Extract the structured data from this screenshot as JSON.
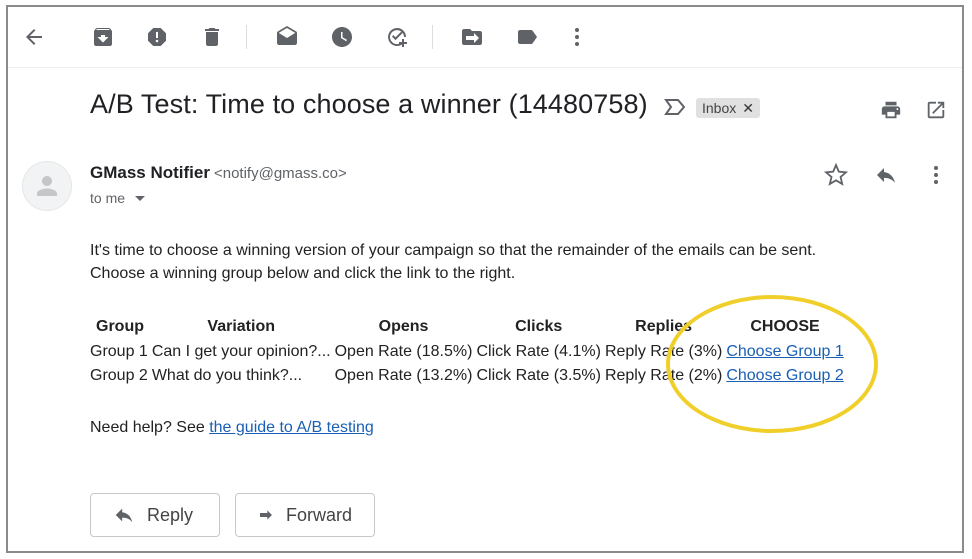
{
  "toolbar": {
    "icons": [
      "back-arrow-icon",
      "archive-icon",
      "report-spam-icon",
      "delete-icon",
      "mark-unread-icon",
      "snooze-icon",
      "add-to-tasks-icon",
      "move-to-icon",
      "label-icon",
      "more-vert-icon"
    ]
  },
  "email": {
    "subject": "A/B Test: Time to choose a winner (14480758)",
    "label_chip": "Inbox",
    "sender_name": "GMass Notifier",
    "sender_email": "<notify@gmass.co>",
    "to": "to me",
    "body_line1": "It's time to choose a winning version of your campaign so that the remainder of the emails can be sent.",
    "body_line2": "Choose a winning group below and click the link to the right.",
    "help_prefix": "Need help? See ",
    "help_link": "the guide to A/B testing"
  },
  "table": {
    "headers": {
      "group": "Group",
      "variation": "Variation",
      "opens": "Opens",
      "clicks": "Clicks",
      "replies": "Replies",
      "choose": "CHOOSE"
    },
    "rows": [
      {
        "group": "Group 1",
        "variation": "Can I get your opinion?...",
        "opens": "Open Rate (18.5%)",
        "clicks": "Click Rate (4.1%)",
        "replies": "Reply Rate (3%)",
        "choose": "Choose Group 1"
      },
      {
        "group": "Group 2",
        "variation": "What do you think?...",
        "opens": "Open Rate (13.2%)",
        "clicks": "Click Rate (3.5%)",
        "replies": "Reply Rate (2%)",
        "choose": "Choose Group 2"
      }
    ]
  },
  "actions": {
    "reply": "Reply",
    "forward": "Forward"
  },
  "colors": {
    "highlight": "#f1cf2a",
    "link": "#1a5fb4"
  }
}
